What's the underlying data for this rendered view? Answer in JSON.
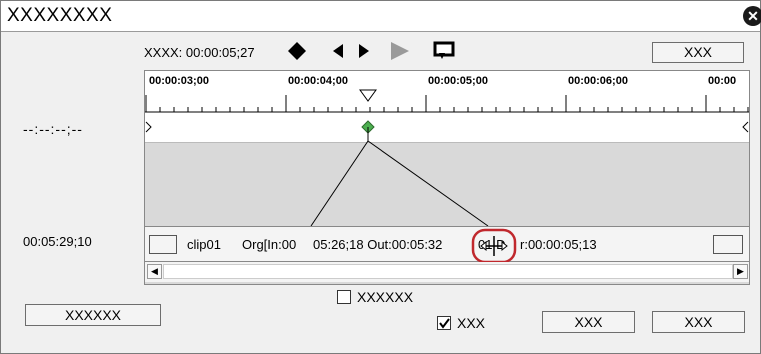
{
  "window": {
    "title": "XXXXXXXX"
  },
  "transport": {
    "label": "XXXX: 00:00:05;27",
    "right_button": "XXX"
  },
  "ruler": {
    "ticks": [
      "00:00:03;00",
      "00:00:04;00",
      "00:00:05;00",
      "00:00:06;00",
      "00:00"
    ]
  },
  "left_labels": {
    "timecode_top": "--:--:--;--",
    "timecode_bottom": "00:05:29;10"
  },
  "clip": {
    "name": "clip01",
    "info_a": "Org[In:00",
    "info_b": "05:26;18 Out:00:05:32",
    "info_c": "01 D",
    "info_d": "r:00:00:05;13"
  },
  "bottom": {
    "left_button": "XXXXXX",
    "checkbox1_label": "XXXXXX",
    "checkbox2_label": "XXX",
    "checkbox2_checked": true,
    "ok_button": "XXX",
    "cancel_button": "XXX"
  },
  "icons": [
    "close-icon",
    "keyframe-diamond-icon",
    "prev-keyframe-icon",
    "next-keyframe-icon",
    "play-icon",
    "loop-playback-icon",
    "resize-horizontal-cursor-icon"
  ],
  "colors": {
    "keyframe": "#4caf50",
    "highlight": "#c0282d"
  }
}
